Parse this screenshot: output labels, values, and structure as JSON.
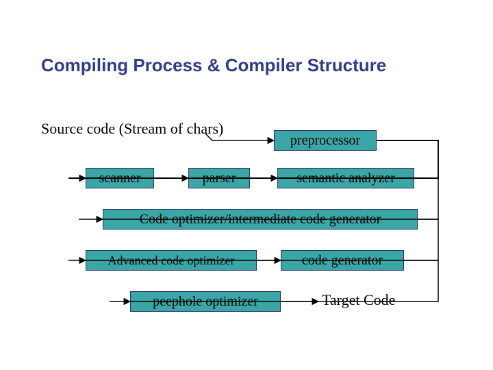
{
  "title": "Compiling Process & Compiler Structure",
  "source_label": "Source code (Stream of chars)",
  "target_label": "Target Code",
  "stages": {
    "preprocessor": "preprocessor",
    "scanner": "scanner",
    "parser": "parser",
    "semantic_analyzer": "semantic analyzer",
    "optimizer_intermediate": "Code optimizer/intermediate code generator",
    "advanced_optimizer": "Advanced code optimizer",
    "code_generator": "code generator",
    "peephole_optimizer": "peephole optimizer"
  },
  "flow": [
    "source",
    "preprocessor",
    "scanner",
    "parser",
    "semantic_analyzer",
    "optimizer_intermediate",
    "advanced_optimizer",
    "code_generator",
    "peephole_optimizer",
    "target"
  ]
}
